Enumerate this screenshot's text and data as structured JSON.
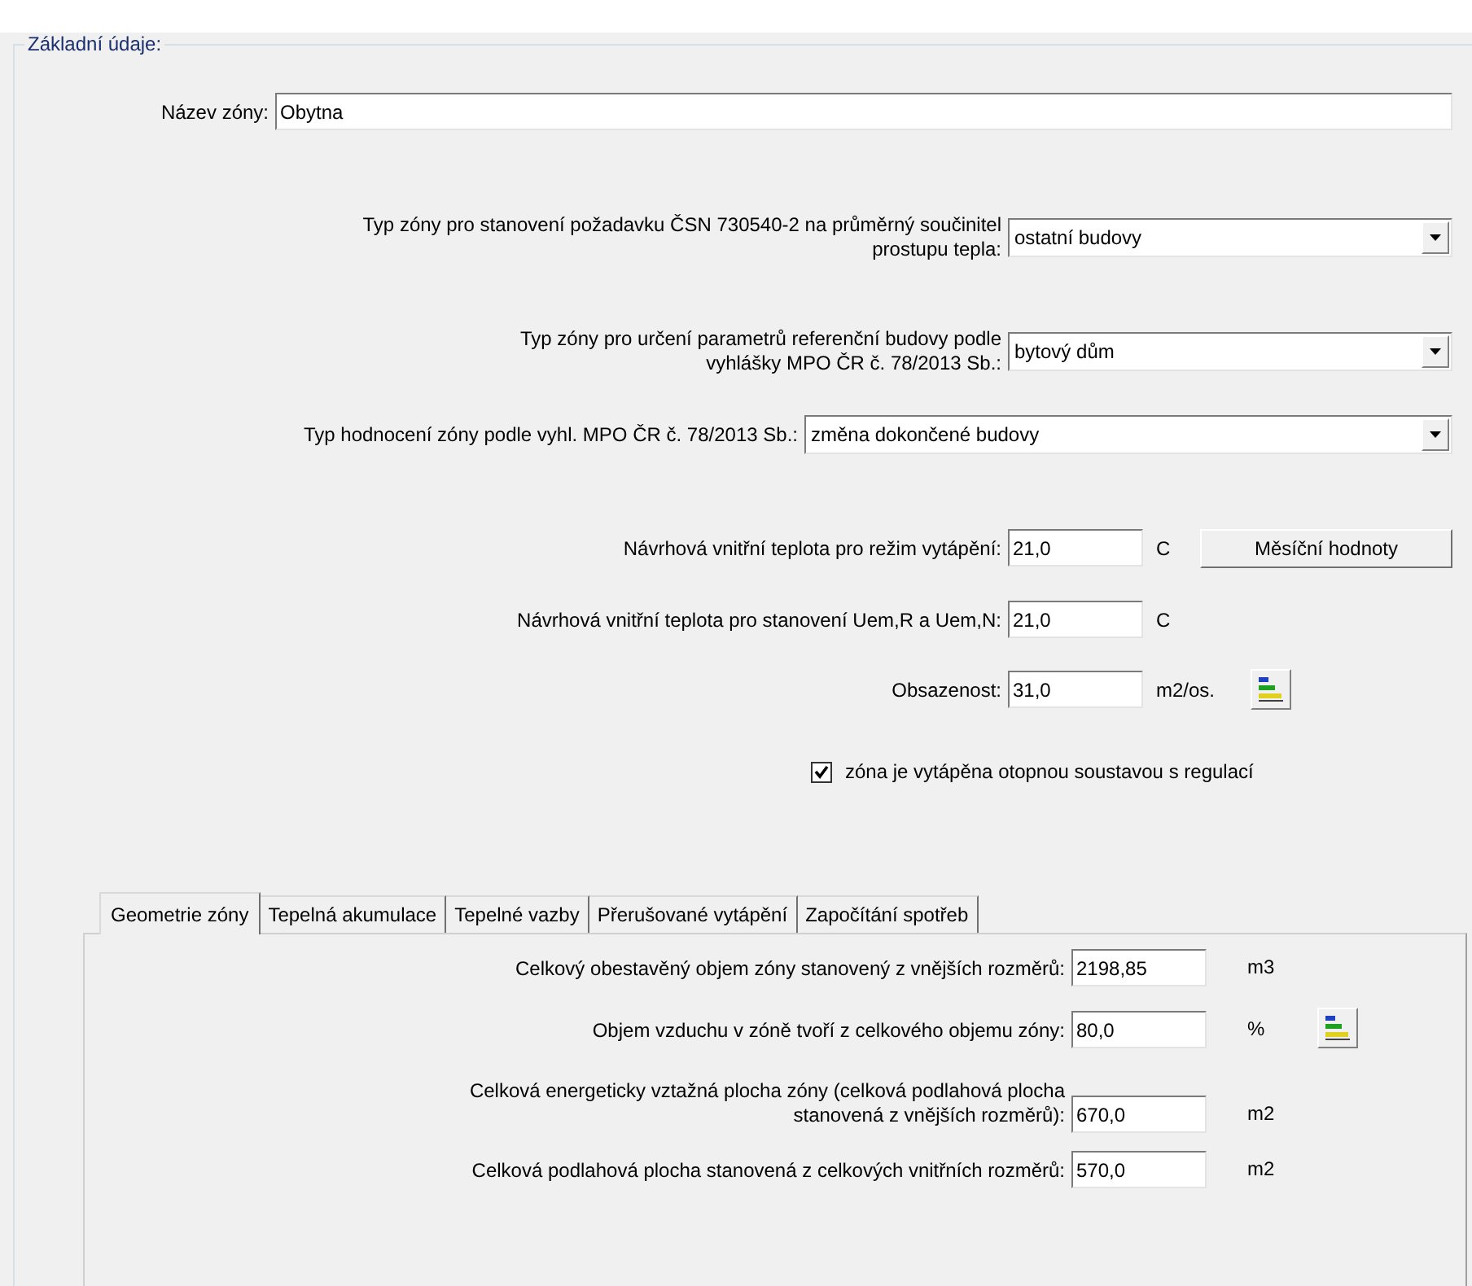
{
  "group_title": "Základní údaje:",
  "zone_name": {
    "label": "Název zóny:",
    "value": "Obytna"
  },
  "selects": [
    {
      "label": "Typ zóny pro stanovení požadavku ČSN 730540-2 na průměrný součinitel\nprostupu tepla:",
      "value": "ostatní budovy",
      "kind": "short"
    },
    {
      "label": "Typ zóny pro určení parametrů referenční budovy podle\nvyhlášky MPO ČR č. 78/2013 Sb.:",
      "value": "bytový dům",
      "kind": "short"
    },
    {
      "label": "Typ hodnocení zóny podle vyhl. MPO ČR č. 78/2013 Sb.:",
      "value": "změna dokončené budovy",
      "kind": "wide"
    }
  ],
  "inputs": [
    {
      "label": "Návrhová vnitřní teplota pro režim vytápění:",
      "value": "21,0",
      "unit": "C",
      "kind": "text_button",
      "button": "Měsíční hodnoty"
    },
    {
      "label": "Návrhová vnitřní teplota pro stanovení Uem,R a Uem,N:",
      "value": "21,0",
      "unit": "C",
      "kind": "plain"
    },
    {
      "label": "Obsazenost:",
      "value": "31,0",
      "unit": "m2/os.",
      "kind": "icon_button"
    }
  ],
  "heating_check": {
    "label": "zóna je vytápěna otopnou soustavou s regulací",
    "checked": true
  },
  "tabs": [
    {
      "label": "Geometrie zóny",
      "selected": true
    },
    {
      "label": "Tepelná akumulace",
      "selected": false
    },
    {
      "label": "Tepelné vazby",
      "selected": false
    },
    {
      "label": "Přerušované vytápění",
      "selected": false
    },
    {
      "label": "Započítání spotřeb",
      "selected": false
    }
  ],
  "tab_fields": [
    {
      "label": "Celkový obestavěný objem zóny stanovený z vnějších rozměrů:",
      "value": "2198,85",
      "unit": "m3",
      "kind": "plain"
    },
    {
      "label": "Objem vzduchu v zóně tvoří z celkového objemu zóny:",
      "value": "80,0",
      "unit": "%",
      "kind": "icon_button"
    },
    {
      "label": "Celková energeticky vztažná plocha zóny (celková podlahová plocha\nstanovená z vnějších rozměrů):",
      "value": "670,0",
      "unit": "m2",
      "kind": "plain"
    },
    {
      "label": "Celková podlahová plocha stanovená z celkových vnitřních rozměrů:",
      "value": "570,0",
      "unit": "m2",
      "kind": "plain"
    }
  ]
}
